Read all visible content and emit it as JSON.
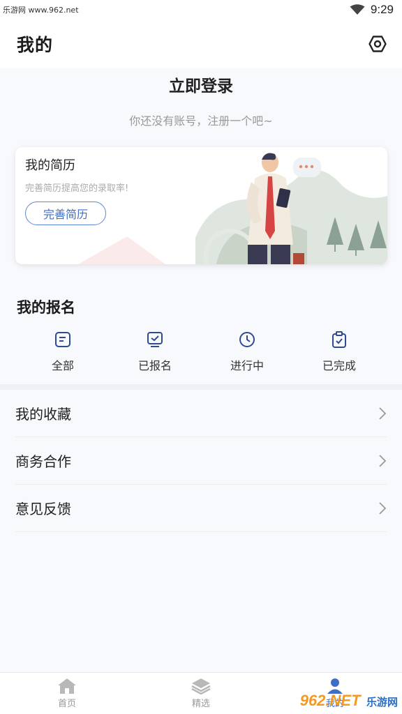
{
  "status_bar": {
    "site": "乐游网 www.962.net",
    "time": "9:29"
  },
  "header": {
    "title": "我的",
    "settings_icon": "gear-icon"
  },
  "login": {
    "title": "立即登录",
    "subtitle": "你还没有账号，注册一个吧~"
  },
  "resume_card": {
    "title": "我的简历",
    "subtitle": "完善简历提高您的录取率!",
    "button": "完善简历"
  },
  "signup": {
    "title": "我的报名",
    "tabs": [
      {
        "label": "全部",
        "icon": "list-icon"
      },
      {
        "label": "已报名",
        "icon": "registered-icon"
      },
      {
        "label": "进行中",
        "icon": "clock-icon"
      },
      {
        "label": "已完成",
        "icon": "clipboard-check-icon"
      }
    ]
  },
  "menu": [
    {
      "label": "我的收藏"
    },
    {
      "label": "商务合作"
    },
    {
      "label": "意见反馈"
    }
  ],
  "tabbar": [
    {
      "label": "首页",
      "icon": "home-icon"
    },
    {
      "label": "精选",
      "icon": "layers-icon"
    },
    {
      "label": "我的",
      "icon": "user-icon"
    }
  ],
  "watermark": {
    "brand": "962.NET",
    "name": "乐游网"
  },
  "colors": {
    "accent": "#3f6ec9",
    "background": "#f8f9fc"
  }
}
